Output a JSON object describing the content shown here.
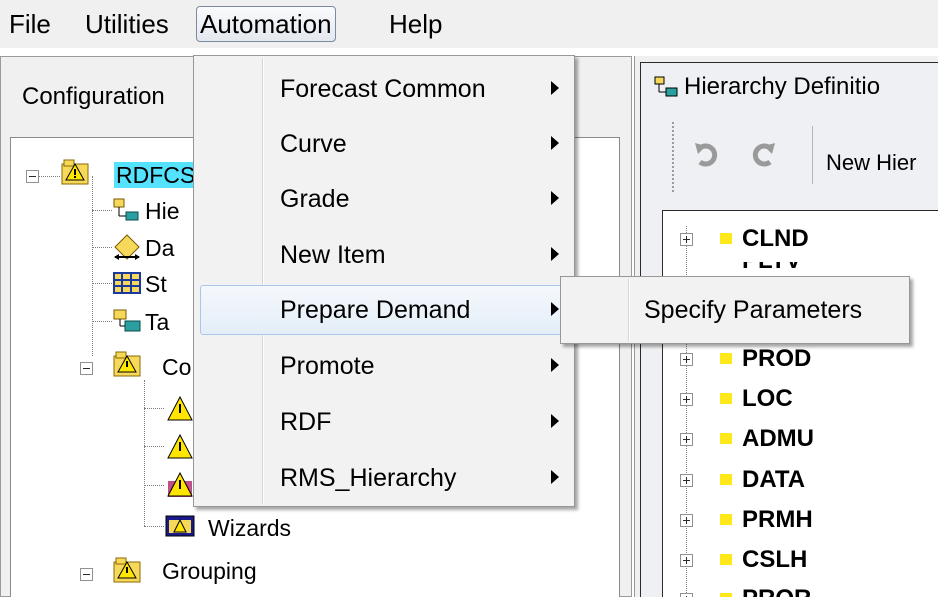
{
  "menubar": {
    "items": [
      {
        "label": "File"
      },
      {
        "label": "Utilities"
      },
      {
        "label": "Automation"
      },
      {
        "label": "Help"
      }
    ]
  },
  "left_panel": {
    "title": "Configuration",
    "tree": {
      "root": "RDFCS",
      "children": [
        "Hie",
        "Da",
        "St",
        "Ta",
        "Co"
      ],
      "wizards": "Wizards",
      "grouping": "Grouping"
    }
  },
  "automation_menu": {
    "items": [
      {
        "label": "Forecast Common"
      },
      {
        "label": "Curve"
      },
      {
        "label": "Grade"
      },
      {
        "label": "New Item"
      },
      {
        "label": "Prepare Demand"
      },
      {
        "label": "Promote"
      },
      {
        "label": "RDF"
      },
      {
        "label": "RMS_Hierarchy"
      }
    ],
    "highlighted_index": 4
  },
  "submenu": {
    "items": [
      {
        "label": "Specify Parameters"
      }
    ]
  },
  "right_panel": {
    "title": "Hierarchy Definitio",
    "toolbar": {
      "new_label": "New Hier"
    },
    "hierarchies": [
      "CLND",
      "PLTV",
      "PROD",
      "LOC",
      "ADMU",
      "DATA",
      "PRMH",
      "CSLH",
      "PROR"
    ]
  },
  "colors": {
    "selection_bg": "#55e2ff",
    "menu_highlight_border": "#a9c7e8",
    "hierarchy_marker": "#ffe81a",
    "window_bg": "#f0f0f0"
  },
  "icons": {
    "tree_folder": "warning-folder-icon",
    "hierarchy": "hierarchy-icon",
    "dimension": "dimension-icon",
    "structure": "structure-grid-icon",
    "task": "task-icon",
    "wizard": "wizard-icon",
    "undo": "undo-icon",
    "redo": "redo-icon",
    "submenu_arrow": "chevron-right-icon"
  }
}
